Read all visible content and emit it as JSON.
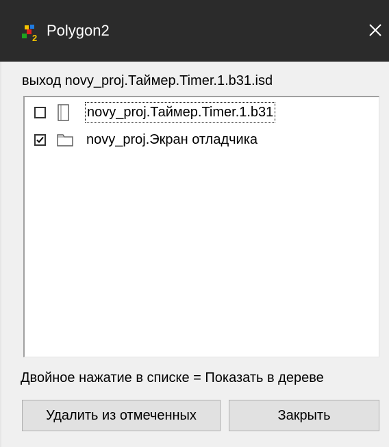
{
  "window": {
    "title": "Polygon2",
    "close_icon": "close-icon",
    "app_icon": "polygon-app-icon"
  },
  "header": {
    "text": "выход novy_proj.Таймер.Timer.1.b31.isd"
  },
  "list": {
    "items": [
      {
        "label": "novy_proj.Таймер.Timer.1.b31",
        "checked": false,
        "icon": "file-icon",
        "focused": true
      },
      {
        "label": "novy_proj.Экран отладчика",
        "checked": true,
        "icon": "folder-icon",
        "focused": false
      }
    ]
  },
  "hint": {
    "text": "Двойное нажатие в списке = Показать в дереве"
  },
  "buttons": {
    "delete_label": "Удалить из отмеченных",
    "close_label": "Закрыть"
  }
}
